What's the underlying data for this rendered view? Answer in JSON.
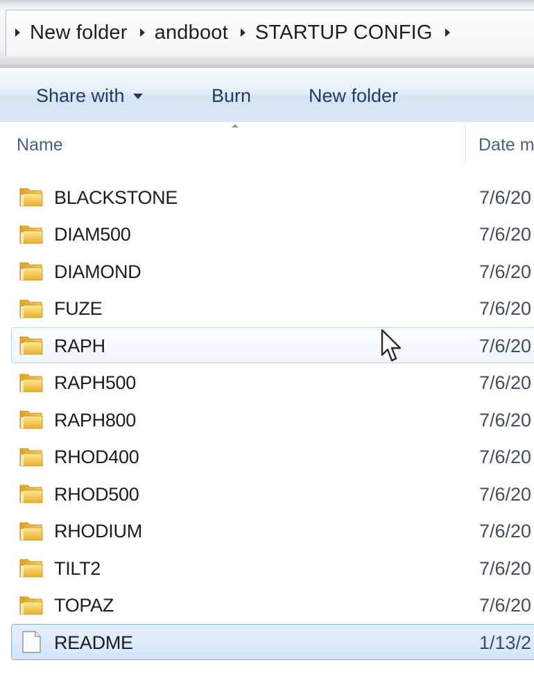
{
  "breadcrumb": {
    "items": [
      "New folder",
      "andboot",
      "STARTUP CONFIG"
    ]
  },
  "toolbar": {
    "share_label": "Share with",
    "burn_label": "Burn",
    "new_folder_label": "New folder"
  },
  "columns": {
    "name": "Name",
    "date": "Date m"
  },
  "files": [
    {
      "name": "BLACKSTONE",
      "date": "7/6/20",
      "type": "folder",
      "state": "normal"
    },
    {
      "name": "DIAM500",
      "date": "7/6/20",
      "type": "folder",
      "state": "normal"
    },
    {
      "name": "DIAMOND",
      "date": "7/6/20",
      "type": "folder",
      "state": "normal"
    },
    {
      "name": "FUZE",
      "date": "7/6/20",
      "type": "folder",
      "state": "normal"
    },
    {
      "name": "RAPH",
      "date": "7/6/20",
      "type": "folder",
      "state": "hover"
    },
    {
      "name": "RAPH500",
      "date": "7/6/20",
      "type": "folder",
      "state": "normal"
    },
    {
      "name": "RAPH800",
      "date": "7/6/20",
      "type": "folder",
      "state": "normal"
    },
    {
      "name": "RHOD400",
      "date": "7/6/20",
      "type": "folder",
      "state": "normal"
    },
    {
      "name": "RHOD500",
      "date": "7/6/20",
      "type": "folder",
      "state": "normal"
    },
    {
      "name": "RHODIUM",
      "date": "7/6/20",
      "type": "folder",
      "state": "normal"
    },
    {
      "name": "TILT2",
      "date": "7/6/20",
      "type": "folder",
      "state": "normal"
    },
    {
      "name": "TOPAZ",
      "date": "7/6/20",
      "type": "folder",
      "state": "normal"
    },
    {
      "name": "README",
      "date": "1/13/2",
      "type": "file",
      "state": "selected"
    }
  ],
  "icons": {
    "folder": "folder-icon",
    "file": "document-icon"
  },
  "colors": {
    "toolbar_text": "#1e3c62",
    "header_text": "#4c607a",
    "hover_border": "#b8d6fb",
    "selected_border": "#84acdd",
    "folder_yellow": "#f2c744"
  }
}
